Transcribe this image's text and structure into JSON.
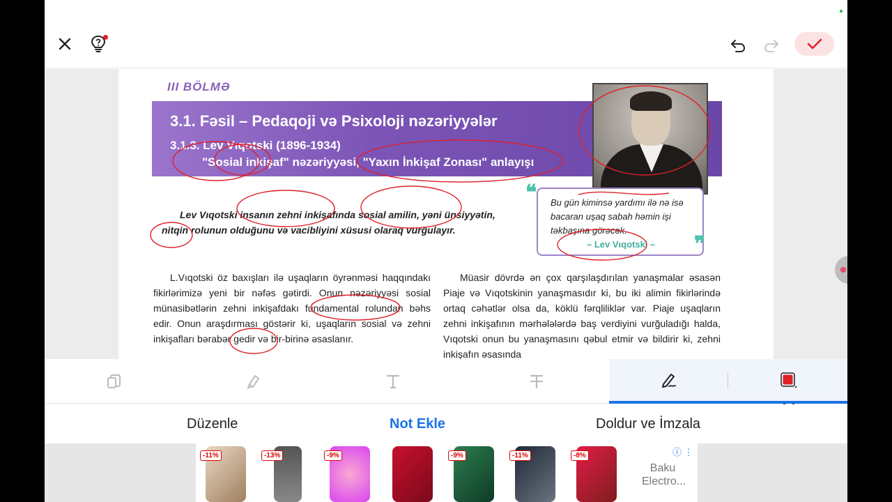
{
  "toolbar": {
    "close_icon": "close-icon",
    "hint_icon": "lightbulb-help-icon",
    "undo_icon": "undo-icon",
    "redo_icon": "redo-icon",
    "confirm_icon": "checkmark-icon"
  },
  "document": {
    "section_label": "III BÖLMƏ",
    "banner_title": "3.1. Fəsil – Pedaqoji və Psixoloji nəzəriyyələr",
    "banner_subtitle": "3.1.3. Lev Vıqotski (1896-1934)",
    "banner_subtitle2": "\"Sosial inkişaf\" nəzəriyyəsi, \"Yaxın İnkişaf Zonası\" anlayışı",
    "intro": "Lev Vıqotski insanın zehni inkişafında sosial amilin, yəni ünsiyyətin, nitqin rolunun olduğunu və vacibliyini xüsusi olaraq vurğulayır.",
    "quote": "Bu gün kiminsə yardımı ilə nə isə bacaran uşaq sabah həmin işi təkbaşına görəcək.",
    "quote_author": "– Lev Vıqotski –",
    "col_left": "L.Vıqotski öz baxışları ilə uşaqların öyrənməsi haqqındakı fikirlərimizə yeni bir nəfəs gətirdi. Onun nəzəriyyəsi sosial münasibətlərin zehni inkişafdakı fundamental rolundan bəhs edir. Onun araşdırması göstərir ki, uşaqların sosial və zehni inkişafları bərabər gedir və bir-birinə əsaslanır.",
    "col_right": "Müasir dövrdə ən çox qarşılaşdırılan yanaşmalar əsasən Piaje və Vıqotskinin yanaşmasıdır ki, bu iki alimin fikirlərində ortaq cəhətlər olsa da, köklü fərqliliklər var. Piaje uşaqların zehni inkişafının mərhələlərdə baş verdiyini vurğuladığı halda, Vıqotski onun bu yanaşmasını qəbul etmir və bildirir ki, zehni inkişafın əsasında"
  },
  "tools": [
    "copy-icon",
    "highlighter-icon",
    "text-icon",
    "strikethrough-icon",
    "pen-icon",
    "color-icon"
  ],
  "colors": {
    "accent": "#1a73e8",
    "pen": "#e0202a"
  },
  "modes": {
    "edit": "Düzenle",
    "note": "Not Ekle",
    "fill": "Doldur ve İmzala"
  },
  "ad": {
    "badges": [
      "-11%",
      "-13%",
      "-9%",
      "",
      "-9%",
      "-11%",
      "-8%"
    ],
    "text": "Baku Electro..."
  }
}
